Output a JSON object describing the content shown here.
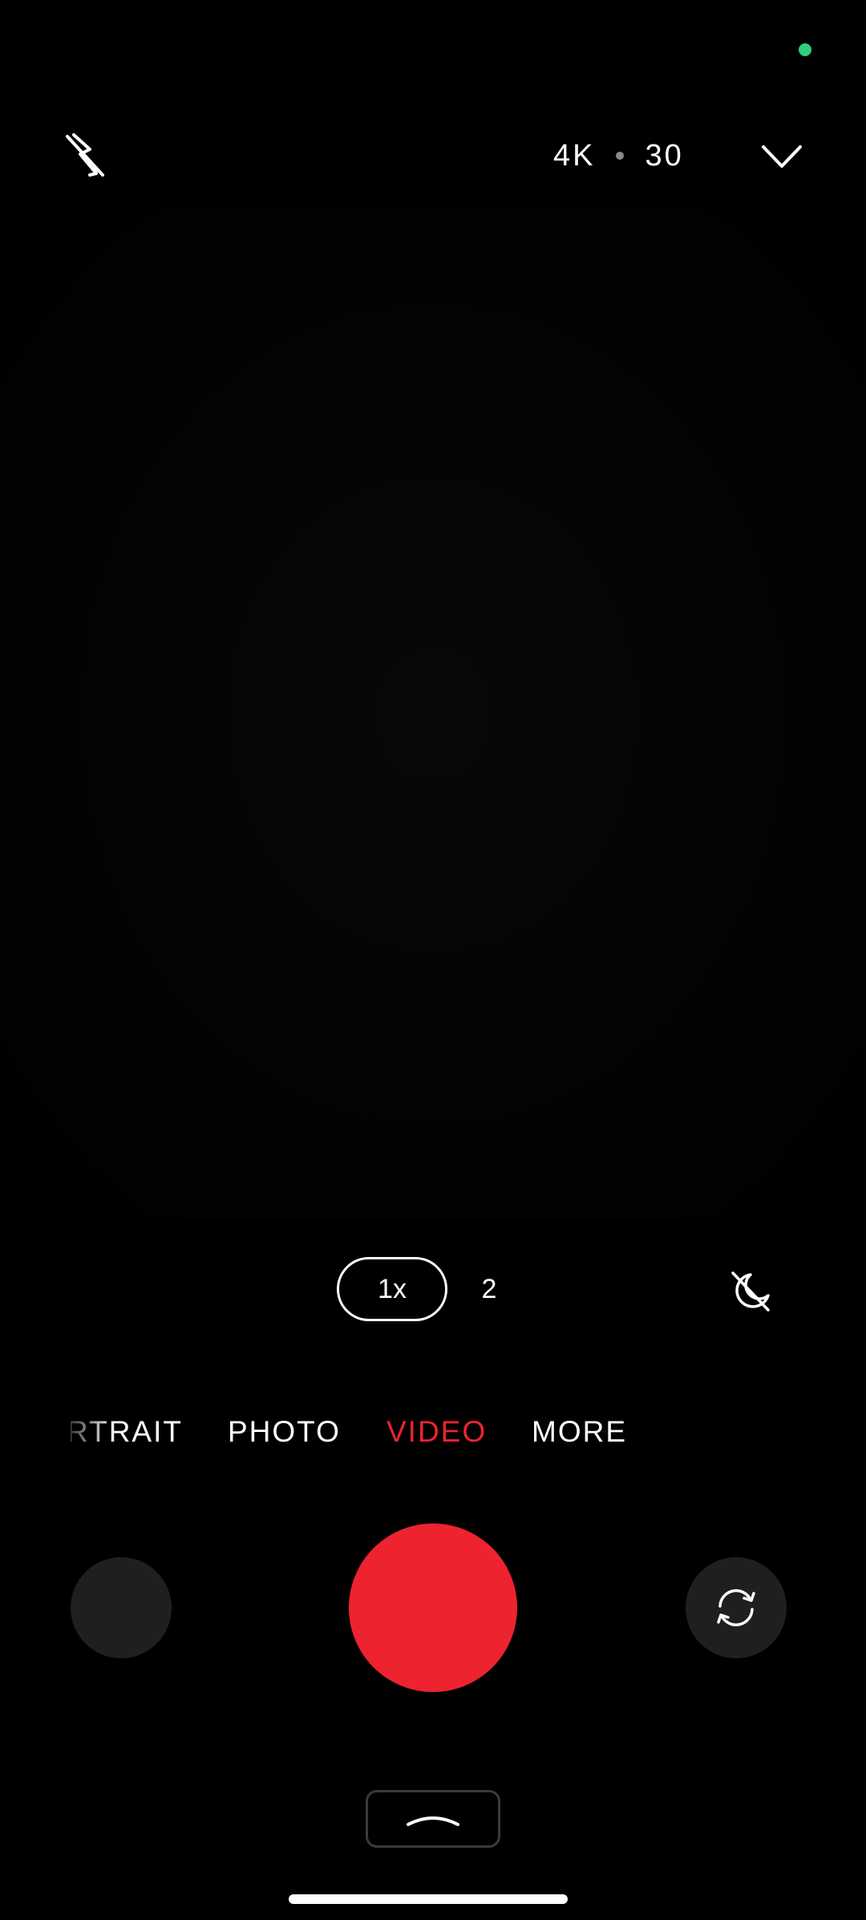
{
  "colors": {
    "background": "#000000",
    "accent_red": "#ED2330",
    "privacy_dot": "#2FD17A",
    "text": "#FFFFFF",
    "muted_dot": "#8A8A8A",
    "button_fill": "#1F1F1F"
  },
  "top_bar": {
    "flash_icon": "flash-off-icon",
    "resolution": "4K",
    "fps": "30",
    "more_icon": "chevron-down-icon"
  },
  "zoom": {
    "active_label": "1x",
    "secondary_label": "2"
  },
  "night_icon": "night-mode-off-icon",
  "modes": {
    "items": [
      "PORTRAIT",
      "PHOTO",
      "VIDEO",
      "MORE"
    ],
    "selected": "VIDEO"
  },
  "bottom": {
    "gallery_icon": "gallery-thumbnail",
    "shutter_icon": "record-button",
    "switch_icon": "switch-camera-icon",
    "expand_icon": "chevron-up-icon"
  }
}
